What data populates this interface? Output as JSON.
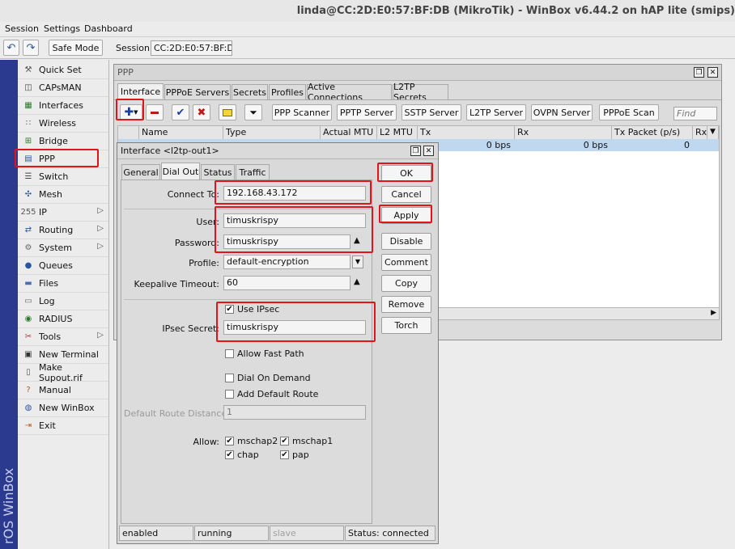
{
  "window": {
    "title": "linda@CC:2D:E0:57:BF:DB (MikroTik) - WinBox v6.44.2 on hAP lite (smips)"
  },
  "menu": [
    "Session",
    "Settings",
    "Dashboard"
  ],
  "toolbar": {
    "undo_icon": "undo-icon",
    "redo_icon": "redo-icon",
    "safe_mode": "Safe Mode",
    "session_label": "Session:",
    "session_value": "CC:2D:E0:57:BF:DB"
  },
  "brand": "rOS WinBox",
  "sidebar": {
    "items": [
      {
        "label": "Quick Set",
        "icon": "quick-set-icon",
        "arrow": ""
      },
      {
        "label": "CAPsMAN",
        "icon": "capsman-icon",
        "arrow": ""
      },
      {
        "label": "Interfaces",
        "icon": "interfaces-icon",
        "arrow": ""
      },
      {
        "label": "Wireless",
        "icon": "wireless-icon",
        "arrow": ""
      },
      {
        "label": "Bridge",
        "icon": "bridge-icon",
        "arrow": ""
      },
      {
        "label": "PPP",
        "icon": "ppp-icon",
        "arrow": ""
      },
      {
        "label": "Switch",
        "icon": "switch-icon",
        "arrow": ""
      },
      {
        "label": "Mesh",
        "icon": "mesh-icon",
        "arrow": ""
      },
      {
        "label": "IP",
        "icon": "ip-icon",
        "arrow": "▷"
      },
      {
        "label": "Routing",
        "icon": "routing-icon",
        "arrow": "▷"
      },
      {
        "label": "System",
        "icon": "system-icon",
        "arrow": "▷"
      },
      {
        "label": "Queues",
        "icon": "queues-icon",
        "arrow": ""
      },
      {
        "label": "Files",
        "icon": "files-icon",
        "arrow": ""
      },
      {
        "label": "Log",
        "icon": "log-icon",
        "arrow": ""
      },
      {
        "label": "RADIUS",
        "icon": "radius-icon",
        "arrow": ""
      },
      {
        "label": "Tools",
        "icon": "tools-icon",
        "arrow": "▷"
      },
      {
        "label": "New Terminal",
        "icon": "terminal-icon",
        "arrow": ""
      },
      {
        "label": "Make Supout.rif",
        "icon": "supout-icon",
        "arrow": ""
      },
      {
        "label": "Manual",
        "icon": "manual-icon",
        "arrow": ""
      },
      {
        "label": "New WinBox",
        "icon": "winbox-icon",
        "arrow": ""
      },
      {
        "label": "Exit",
        "icon": "exit-icon",
        "arrow": ""
      }
    ]
  },
  "ppp": {
    "title": "PPP",
    "tabs": [
      "Interface",
      "PPPoE Servers",
      "Secrets",
      "Profiles",
      "Active Connections",
      "L2TP Secrets"
    ],
    "buttons": [
      "PPP Scanner",
      "PPTP Server",
      "SSTP Server",
      "L2TP Server",
      "OVPN Server",
      "PPPoE Scan"
    ],
    "find_placeholder": "Find",
    "columns": [
      "Name",
      "Type",
      "Actual MTU",
      "L2 MTU",
      "Tx",
      "Rx",
      "Tx Packet (p/s)",
      "Rx"
    ],
    "row": {
      "tx": "0 bps",
      "rx": "0 bps",
      "tx_packet": "0"
    }
  },
  "dialog": {
    "title": "Interface <l2tp-out1>",
    "tabs": [
      "General",
      "Dial Out",
      "Status",
      "Traffic"
    ],
    "connect_to_label": "Connect To:",
    "connect_to": "192.168.43.172",
    "user_label": "User:",
    "user": "timuskrispy",
    "password_label": "Password:",
    "password": "timuskrispy",
    "profile_label": "Profile:",
    "profile": "default-encryption",
    "keepalive_label": "Keepalive Timeout:",
    "keepalive": "60",
    "use_ipsec": "Use IPsec",
    "ipsec_secret_label": "IPsec Secret:",
    "ipsec_secret": "timuskrispy",
    "allow_fast_path": "Allow Fast Path",
    "dial_on_demand": "Dial On Demand",
    "add_default_route": "Add Default Route",
    "default_route_distance_label": "Default Route Distance:",
    "default_route_distance": "1",
    "allow_label": "Allow:",
    "allow": [
      "mschap2",
      "mschap1",
      "chap",
      "pap"
    ],
    "actions": [
      "OK",
      "Cancel",
      "Apply",
      "Disable",
      "Comment",
      "Copy",
      "Remove",
      "Torch"
    ],
    "status": [
      "enabled",
      "running",
      "slave",
      "Status: connected"
    ]
  }
}
